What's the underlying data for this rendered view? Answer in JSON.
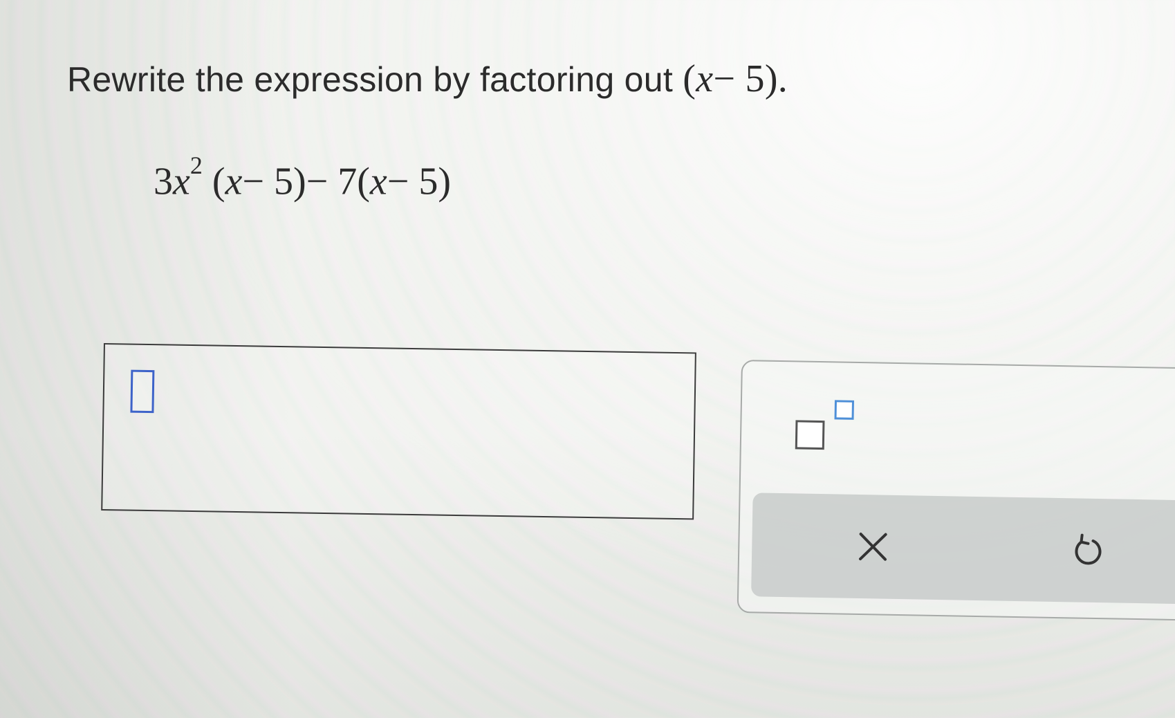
{
  "prompt": {
    "text": "Rewrite the expression by factoring out",
    "factor_open": "(",
    "factor_var": "x",
    "factor_op": "−",
    "factor_num": "5",
    "factor_close": ").",
    "trailing": ""
  },
  "expression": {
    "coef": "3",
    "var": "x",
    "exponent": "2",
    "group1_open": "(",
    "group1_var": "x",
    "group1_op": "−",
    "group1_num": "5",
    "group1_close": ")",
    "op": "−",
    "coef2": "7",
    "group2_open": "(",
    "group2_var": "x",
    "group2_op": "−",
    "group2_num": "5",
    "group2_close": ")"
  },
  "answer": {
    "value": ""
  },
  "toolbar": {
    "exponent_button": "exponent-icon",
    "clear_button": "close-icon",
    "undo_button": "undo-icon"
  },
  "colors": {
    "placeholder_border": "#3d63c9",
    "exponent_power_border": "#4e8fd8",
    "action_bar": "#c8cbca"
  }
}
